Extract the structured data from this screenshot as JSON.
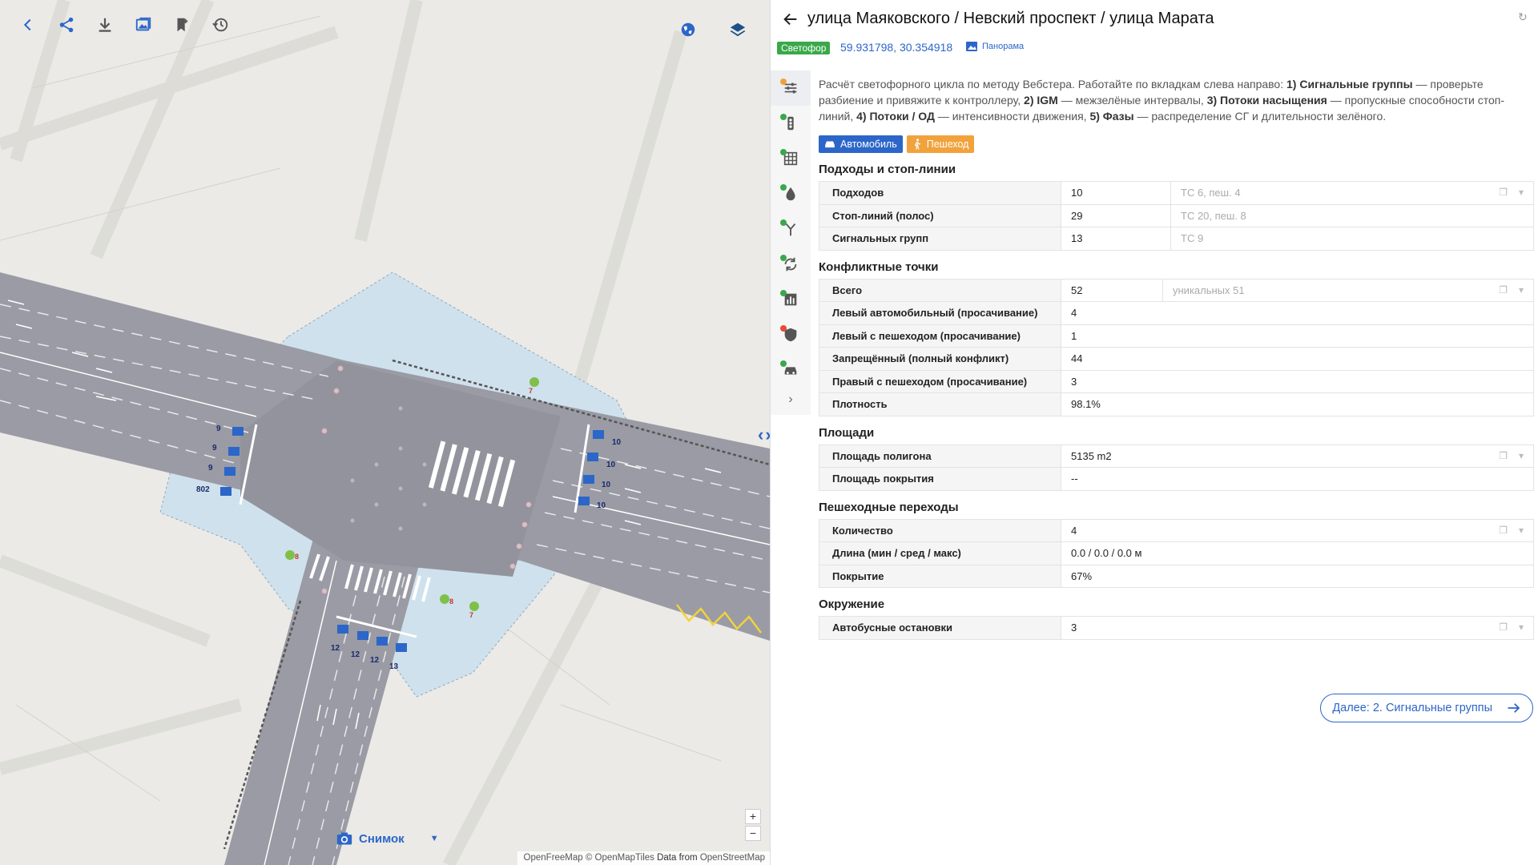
{
  "map": {
    "toolbar": [
      {
        "name": "back-icon",
        "label": "back"
      },
      {
        "name": "share-icon",
        "label": "share"
      },
      {
        "name": "download-icon",
        "label": "download"
      },
      {
        "name": "image-icon",
        "label": "image"
      },
      {
        "name": "bookmark-add-icon",
        "label": "bookmark"
      },
      {
        "name": "history-icon",
        "label": "history"
      }
    ],
    "snapshot_label": "Снимок",
    "zoom_in": "+",
    "zoom_out": "−",
    "attribution_prefix": "OpenFreeMap © OpenMapTiles",
    "attribution_mid": "Data from",
    "attribution_suffix": "OpenStreetMap",
    "lane_counts": {
      "west": [
        "9",
        "9",
        "9",
        "802"
      ],
      "east": [
        "10",
        "10",
        "10",
        "10"
      ],
      "south": [
        "12",
        "12",
        "12",
        "13"
      ]
    },
    "ped_signals": [
      "7",
      "8",
      "8",
      "7"
    ],
    "accent_color": "#2c66c9",
    "road_color": "#9a9ba4",
    "pedestrian_area_color": "#cfe1ec"
  },
  "panel": {
    "title": "улица Маяковского / Невский проспект / улица Марата",
    "badge": "Светофор",
    "badge_color": "#3aa84a",
    "coords": "59.931798, 30.354918",
    "panorama": "Панорама",
    "intro": {
      "p1": "Расчёт светофорного цикла по методу Вебстера. Работайте по вкладкам слева направо: ",
      "b1": "1) Сигнальные группы",
      "p2": " — проверьте разбиение и привяжите к контроллеру, ",
      "b2": "2) IGM",
      "p3": " — межзелёные интервалы, ",
      "b3": "3) Потоки насыщения",
      "p4": " — пропускные способности стоп-линий, ",
      "b4": "4) Потоки / ОД",
      "p5": " — интенсивности движения, ",
      "b5": "5) Фазы",
      "p6": " — распределение СГ и длительности зелёного."
    },
    "modes": {
      "car": "Автомобиль",
      "ped": "Пешеход"
    },
    "sections": [
      {
        "title": "Подходы и стоп-линии",
        "rows": [
          {
            "k": "Подходов",
            "v": "10",
            "n": "ТС 6, пеш. 4"
          },
          {
            "k": "Стоп-линий (полос)",
            "v": "29",
            "n": "ТС 20, пеш. 8"
          },
          {
            "k": "Сигнальных групп",
            "v": "13",
            "n": "ТС 9"
          }
        ]
      },
      {
        "title": "Конфликтные точки",
        "rows": [
          {
            "k": "Всего",
            "v": "52",
            "n": "уникальных 51"
          },
          {
            "k": "Левый автомобильный (просачивание)",
            "v": "4"
          },
          {
            "k": "Левый с пешеходом (просачивание)",
            "v": "1"
          },
          {
            "k": "Запрещённый (полный конфликт)",
            "v": "44"
          },
          {
            "k": "Правый с пешеходом (просачивание)",
            "v": "3"
          },
          {
            "k": "Плотность",
            "v": "98.1%"
          }
        ]
      },
      {
        "title": "Площади",
        "rows": [
          {
            "k": "Площадь полигона",
            "v": "5135 m2"
          },
          {
            "k": "Площадь покрытия",
            "v": "--"
          }
        ]
      },
      {
        "title": "Пешеходные переходы",
        "rows": [
          {
            "k": "Количество",
            "v": "4"
          },
          {
            "k": "Длина (мин / сред / макс)",
            "v": "0.0 / 0.0 / 0.0 м"
          },
          {
            "k": "Покрытие",
            "v": "67%"
          }
        ]
      },
      {
        "title": "Окружение",
        "rows": [
          {
            "k": "Автобусные остановки",
            "v": "3"
          }
        ]
      }
    ],
    "next_button": "Далее: 2. Сигнальные группы",
    "sidebar": [
      {
        "name": "tab-settings-icon",
        "dot": "#f2a23c",
        "active": true
      },
      {
        "name": "tab-traffic-light-icon",
        "dot": "#3aa84a"
      },
      {
        "name": "tab-grid-icon",
        "dot": "#3aa84a"
      },
      {
        "name": "tab-drop-icon",
        "dot": "#3aa84a"
      },
      {
        "name": "tab-fork-icon",
        "dot": "#3aa84a"
      },
      {
        "name": "tab-cycle-icon",
        "dot": "#3aa84a"
      },
      {
        "name": "tab-chart-icon",
        "dot": "#3aa84a"
      },
      {
        "name": "tab-shield-icon",
        "dot": "#e84a3c"
      },
      {
        "name": "tab-car-icon",
        "dot": "#3aa84a"
      }
    ]
  }
}
